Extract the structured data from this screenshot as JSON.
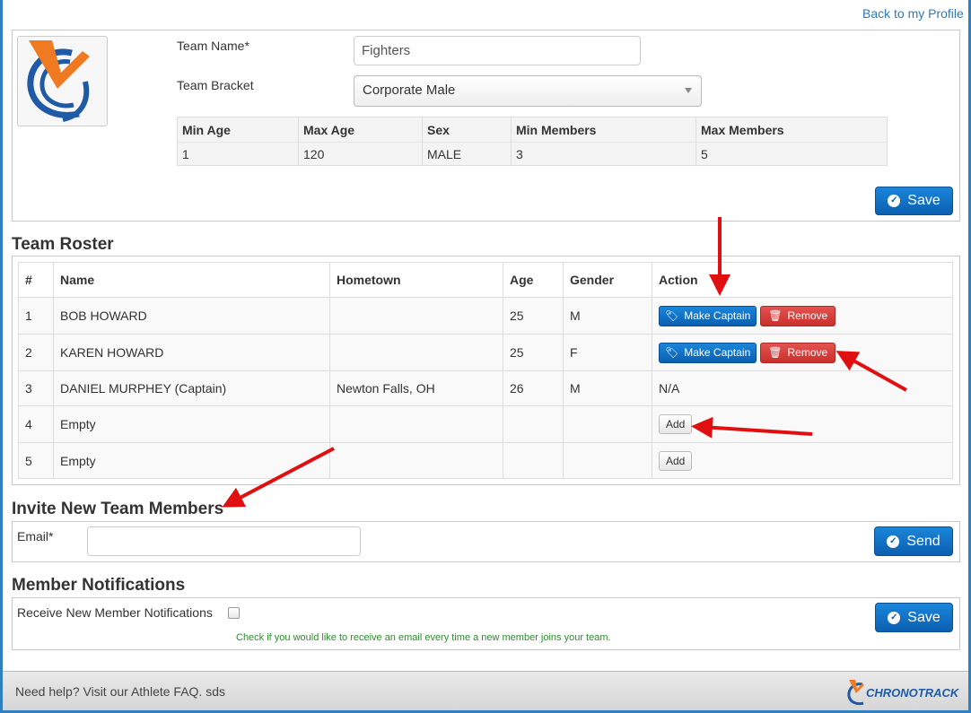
{
  "header": {
    "back_link": "Back to my Profile"
  },
  "team": {
    "name_label": "Team Name*",
    "name_value": "Fighters",
    "bracket_label": "Team Bracket",
    "bracket_value": "Corporate Male",
    "save_label": "Save"
  },
  "bracket_info": {
    "headers": [
      "Min Age",
      "Max Age",
      "Sex",
      "Min Members",
      "Max Members"
    ],
    "values": [
      "1",
      "120",
      "MALE",
      "3",
      "5"
    ]
  },
  "roster": {
    "title": "Team Roster",
    "headers": [
      "#",
      "Name",
      "Hometown",
      "Age",
      "Gender",
      "Action"
    ],
    "make_captain_label": "Make Captain",
    "remove_label": "Remove",
    "add_label": "Add",
    "rows": [
      {
        "num": "1",
        "name": "BOB HOWARD",
        "hometown": "",
        "age": "25",
        "gender": "M",
        "action": ""
      },
      {
        "num": "2",
        "name": "KAREN HOWARD",
        "hometown": "",
        "age": "25",
        "gender": "F",
        "action": ""
      },
      {
        "num": "3",
        "name": "DANIEL MURPHEY (Captain)",
        "hometown": "Newton Falls, OH",
        "age": "26",
        "gender": "M",
        "action": "N/A"
      },
      {
        "num": "4",
        "name": "Empty",
        "hometown": "",
        "age": "",
        "gender": "",
        "action": ""
      },
      {
        "num": "5",
        "name": "Empty",
        "hometown": "",
        "age": "",
        "gender": "",
        "action": ""
      }
    ]
  },
  "invite": {
    "title": "Invite New Team Members",
    "email_label": "Email*",
    "email_value": "",
    "send_label": "Send"
  },
  "notifications": {
    "title": "Member Notifications",
    "checkbox_label": "Receive New Member Notifications",
    "help_text": "Check if you would like to receive an email every time a new member joins your team.",
    "save_label": "Save"
  },
  "footer": {
    "help_text": "Need help? Visit our Athlete FAQ. sds",
    "brand": "CHRONOTRACK"
  },
  "colors": {
    "primary": "#0b5fb0",
    "danger": "#c9302c",
    "link": "#2a7ac0",
    "annotation_arrow": "#e01010"
  }
}
